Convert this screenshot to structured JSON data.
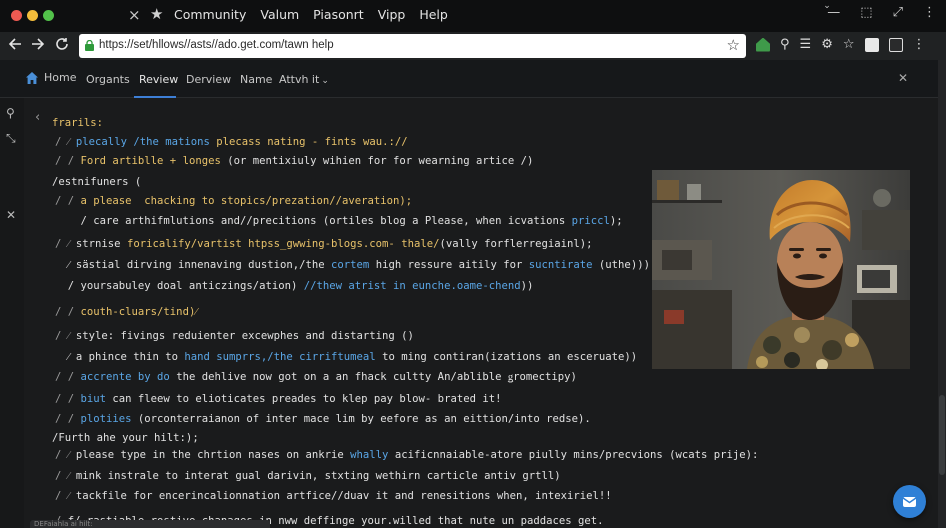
{
  "tabbar": {
    "close_icon": "×",
    "star_icon": "★",
    "menus": [
      "Community",
      "Valum",
      "Piasonrt",
      "Vipp",
      "Help"
    ],
    "window_controls": [
      "—",
      "⬚",
      "⤢",
      "⋮"
    ]
  },
  "navbar": {
    "url": "https://set/hllows//asts//ado.get.com/tawn help",
    "icons": [
      "back-icon",
      "forward-icon",
      "reload-icon",
      "lock-icon",
      "bookmark-star-icon",
      "extension-house-icon",
      "search-icon",
      "list-icon",
      "gear-icon",
      "star-outline-icon",
      "puzzle-icon",
      "sidebar-icon",
      "menu-icon"
    ]
  },
  "sitenav": {
    "home": "Home",
    "items": [
      "Organts",
      "Review",
      "Derview",
      "Name"
    ],
    "dropdown": "Attvh it",
    "active": "Review"
  },
  "code": {
    "lines": [
      [
        {
          "t": "frarils:",
          "c": "kw"
        }
      ],
      [
        {
          "t": "/ ",
          "c": "cm"
        },
        {
          "t": "⁄ ",
          "c": "cm"
        },
        {
          "t": "plecally ",
          "c": "bl"
        },
        {
          "t": "/the mations ",
          "c": "bl"
        },
        {
          "t": "plecass nating - fints wau.://",
          "c": "kw"
        }
      ],
      [
        {
          "t": "/ / ",
          "c": "cm"
        },
        {
          "t": "Ford artiblle + longes",
          "c": "kw"
        },
        {
          "t": " (or mentixiuly wihien for for wearning artice /)",
          "c": ""
        }
      ],
      [
        {
          "t": "/estnifuners (",
          "c": ""
        }
      ],
      [
        {
          "t": "/ / ",
          "c": "cm"
        },
        {
          "t": "a please  chacking to stopics/prezation//averation);",
          "c": "kw"
        }
      ],
      [
        {
          "t": "    / care arthifmlutions and//precitions (ortiles blog a Please, when icvations ",
          "c": ""
        },
        {
          "t": "priccl",
          "c": "bl"
        },
        {
          "t": ");",
          "c": ""
        }
      ],
      [
        {
          "t": "/ ⁄ ",
          "c": "cm"
        },
        {
          "t": "strnise ",
          "c": ""
        },
        {
          "t": "foricalify/vartist htpss_gwwing-blogs.com- thale/",
          "c": "kw"
        },
        {
          "t": "(vally forflerregiainl);",
          "c": ""
        }
      ],
      [
        {
          "t": "  ⁄ sästial dirving innenaving dustion,/the ",
          "c": ""
        },
        {
          "t": "cortem",
          "c": "bl"
        },
        {
          "t": " high ressure aitily for ",
          "c": ""
        },
        {
          "t": "sucntirate",
          "c": "bl"
        },
        {
          "t": " (uthe))):",
          "c": ""
        }
      ],
      [
        {
          "t": "  / yoursabuley doal anticzings/ation) ",
          "c": ""
        },
        {
          "t": "//thew atrist in eunche.oame-chend",
          "c": "bl"
        },
        {
          "t": "))",
          "c": ""
        }
      ],
      [
        {
          "t": "/ / ",
          "c": "cm"
        },
        {
          "t": "couth-cluars/tind)⁄",
          "c": "kw"
        }
      ],
      [
        {
          "t": "/ ⁄ ",
          "c": "cm"
        },
        {
          "t": "style: fivings reduienter excewphes and distarting ()",
          "c": ""
        }
      ],
      [
        {
          "t": "  ⁄ a phince thin to ",
          "c": ""
        },
        {
          "t": "hand sumprrs,/the cirriftumeal",
          "c": "bl"
        },
        {
          "t": " to ming contiran(izations an esceruate))",
          "c": ""
        }
      ],
      [
        {
          "t": "/ / ",
          "c": "cm"
        },
        {
          "t": "accrente by do",
          "c": "bl"
        },
        {
          "t": " the dehlive now got on a an fhack cultty An/ablible ",
          "c": ""
        },
        {
          "t": "ǥromectipy)",
          "c": ""
        }
      ],
      [
        {
          "t": "/ / ",
          "c": "cm"
        },
        {
          "t": "biut",
          "c": "bl"
        },
        {
          "t": " can fleew to elioticates preades to klep pay blow- brated it!",
          "c": ""
        }
      ],
      [
        {
          "t": "/ / ",
          "c": "cm"
        },
        {
          "t": "plotiies",
          "c": "bl"
        },
        {
          "t": " (orconterraianon of inter mace lim by eefore as an eittion/into redse).",
          "c": ""
        }
      ],
      [
        {
          "t": "/Furth ahe your hilt:);",
          "c": ""
        }
      ],
      [
        {
          "t": "/ ⁄ ",
          "c": "cm"
        },
        {
          "t": "please type in the chrtion nases on ankrie ",
          "c": ""
        },
        {
          "t": "whally",
          "c": "bl"
        },
        {
          "t": " acificnnaiable-atore piully mins/precvions (wcats prije):",
          "c": ""
        }
      ],
      [
        {
          "t": "/ ⁄ ",
          "c": "cm"
        },
        {
          "t": "mink instrale to interat gual darivin, stxting wethirn carticle antiv grtll)",
          "c": ""
        }
      ],
      [
        {
          "t": "/ ⁄ ",
          "c": "cm"
        },
        {
          "t": "tackfile for encerincalionnation artfice//duav it and renesitions when, intexiriel!!",
          "c": ""
        }
      ],
      [
        {
          "t": "/ ",
          "c": "cm"
        },
        {
          "t": "f/ rastiable rostive chanages in nww deffinge your.willed that nute un paddaces get.",
          "c": ""
        }
      ]
    ]
  },
  "bottom_tab": "DEFaiahla ai hilt:",
  "colors": {
    "accent": "#3d7fd6",
    "keyword": "#e8c26a",
    "link": "#5aa6e6",
    "fab": "#2f80d6"
  }
}
